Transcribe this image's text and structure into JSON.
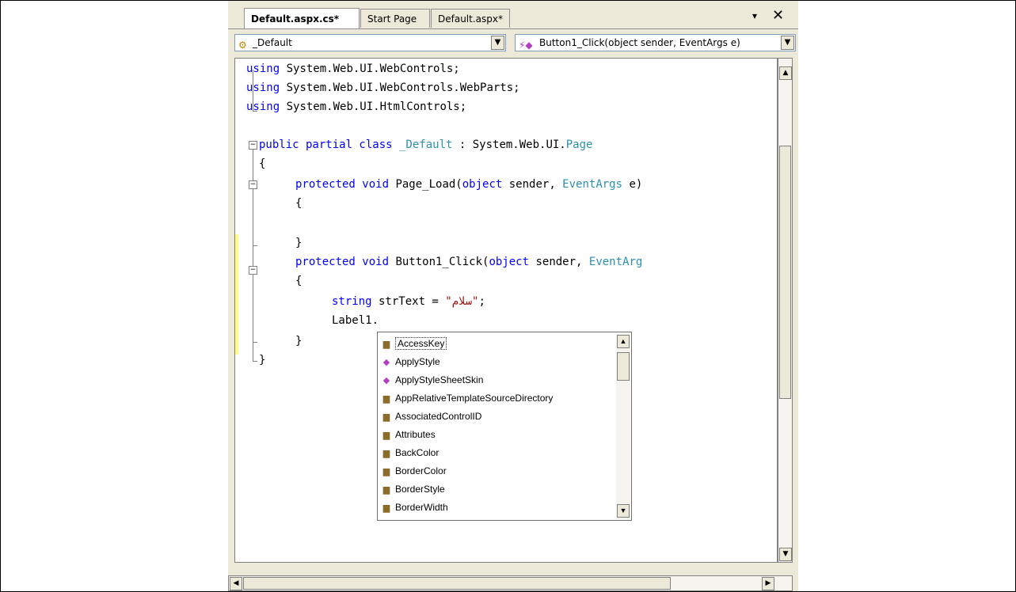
{
  "tabs": [
    {
      "label": "Default.aspx.cs*"
    },
    {
      "label": "Start Page"
    },
    {
      "label": "Default.aspx*"
    }
  ],
  "tab_controls": {
    "dropdown": "▾",
    "close": "✕"
  },
  "dropdowns": {
    "class": "_Default",
    "member": "Button1_Click(object sender, EventArgs e)"
  },
  "code": {
    "l1_kw": "using",
    "l1_rest": " System.Web.UI.WebControls;",
    "l2_kw": "using",
    "l2_rest": " System.Web.UI.WebControls.WebParts;",
    "l3_kw": "using",
    "l3_rest": " System.Web.UI.HtmlControls;",
    "l5_kw": "public partial class",
    "l5_cls": " _Default",
    "l5_mid": " : System.Web.UI.",
    "l5_ty": "Page",
    "l6": "{",
    "l7_kw": "protected void",
    "l7_mid": " Page_Load(",
    "l7_kw2": "object",
    "l7_mid2": " sender, ",
    "l7_ty": "EventArgs",
    "l7_end": " e)",
    "l8": "{",
    "l10": "}",
    "l11_kw": "protected void",
    "l11_mid": " Button1_Click(",
    "l11_kw2": "object",
    "l11_mid2": " sender, ",
    "l11_ty": "EventArg",
    "l12": "{",
    "l13_kw": "string",
    "l13_mid": " strText = ",
    "l13_str": "\"سلام\"",
    "l13_end": ";",
    "l14": "Label1.",
    "l15": "}",
    "l16": "}"
  },
  "intellisense": {
    "items": [
      {
        "label": "AccessKey",
        "icon": "property-icon"
      },
      {
        "label": "ApplyStyle",
        "icon": "method-icon"
      },
      {
        "label": "ApplyStyleSheetSkin",
        "icon": "method-icon"
      },
      {
        "label": "AppRelativeTemplateSourceDirectory",
        "icon": "property-icon"
      },
      {
        "label": "AssociatedControlID",
        "icon": "property-icon"
      },
      {
        "label": "Attributes",
        "icon": "property-icon"
      },
      {
        "label": "BackColor",
        "icon": "property-icon"
      },
      {
        "label": "BorderColor",
        "icon": "property-icon"
      },
      {
        "label": "BorderStyle",
        "icon": "property-icon"
      },
      {
        "label": "BorderWidth",
        "icon": "property-icon"
      }
    ]
  }
}
